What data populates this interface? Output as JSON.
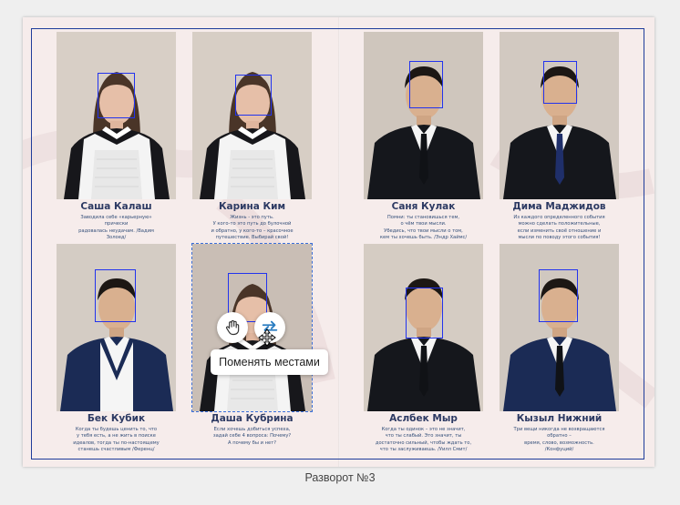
{
  "spread": {
    "caption": "Разворот №3"
  },
  "students": [
    {
      "name": "Саша Калаш",
      "quote": "Заводила себе «карьерную»\nпрически\nрадовалась неудачам. /Вадим\nЗолоед/",
      "gender": "f",
      "selected": false
    },
    {
      "name": "Карина Ким",
      "quote": "Жизнь - это путь.\nУ кого-то это путь до булочной\nи обратно, у кого-то – красочное\nпутешествие. Выбирай свой!",
      "gender": "f",
      "selected": false
    },
    {
      "name": "Саня Кулак",
      "quote": "Помни: ты становишься тем,\nо чём твои мысли.\nУбедись, что твои мысли о том,\nкем ты хочешь быть. /Эндр Хаймс/",
      "gender": "m",
      "selected": false
    },
    {
      "name": "Дима Маджидов",
      "quote": "Из каждого определенного события\nможно сделать положительные,\nесли изменить своё отношение и\nмысли по поводу этого события!",
      "gender": "m",
      "selected": false
    },
    {
      "name": "Бек Кубик",
      "quote": "Когда ты будешь ценить то, что\nу тебя есть, а не жить в поиске\nидеалов, тогда ты по-настоящему\nстанешь счастливым /Ференц/",
      "gender": "m",
      "selected": false
    },
    {
      "name": "Даша Кубрина",
      "quote": "Если хочешь добиться успеха,\nзадай себе 4 вопроса: Почему?\nА почему бы и нет?",
      "gender": "f",
      "selected": true
    },
    {
      "name": "Аслбек Мыр",
      "quote": "Когда ты одинок – это не значит,\nчто ты слабый. Это значит, ты\nдостаточно сильный, чтобы ждать то,\nчто ты заслуживаешь. /Уилл Смит/",
      "gender": "m",
      "selected": false
    },
    {
      "name": "Кызыл Нижний",
      "quote": "Три вещи никогда не возвращаются\nобратно –\nвремя, слово, возможность.\n/Конфуций/",
      "gender": "m",
      "selected": false
    }
  ],
  "actions": {
    "drag_icon": "hand-grab-icon",
    "swap_icon": "swap-arrows-icon",
    "tooltip": "Поменять местами"
  },
  "colors": {
    "guide": "#1f3c9a",
    "face_box": "#2233ee",
    "name": "#2d3a63",
    "page": "#f6eceb"
  }
}
